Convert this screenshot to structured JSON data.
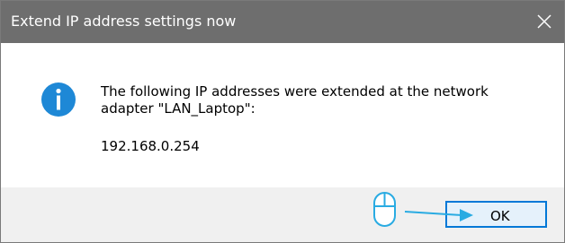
{
  "dialog": {
    "title": "Extend IP address settings now",
    "close_glyph": "×",
    "message": "The following IP addresses were extended at the network adapter \"LAN_Laptop\":",
    "ip_address": "192.168.0.254",
    "info_icon": "information-icon",
    "ok_label": "OK"
  },
  "annotation": {
    "mouse_icon": "mouse-icon",
    "arrow_icon": "arrow-right-icon",
    "color": "#29abe2"
  },
  "colors": {
    "titlebar": "#6e6e6e",
    "info_icon": "#1e88d6",
    "footer": "#f0f0f0",
    "ok_border": "#0078d7"
  }
}
